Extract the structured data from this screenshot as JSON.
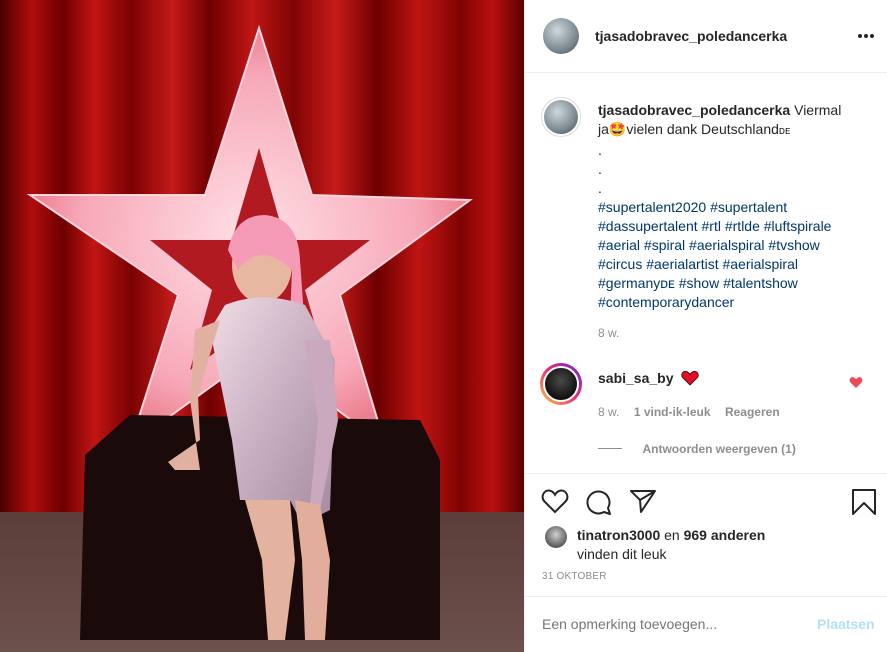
{
  "post": {
    "image_alt": "Photo of an aerial performer in front of an illuminated star"
  },
  "header": {
    "username": "tjasadobravec_poledancerka",
    "more_icon": "more-horizontal-icon"
  },
  "caption": {
    "username": "tjasadobravec_poledancerka",
    "text_line1": "Viermal",
    "text_line2_pre": "ja",
    "emoji": "🤩",
    "text_line2_post": "vielen dank Deutschland",
    "flag": "ᴅᴇ",
    "dots": [
      ".",
      ".",
      "."
    ],
    "hashtags_lines": [
      "#supertalent2020 #supertalent",
      "#dassupertalent #rtl #rtlde #luftspirale",
      "#aerial #spiral #aerialspiral #tvshow",
      "#circus #aerialartist #aerialspiral",
      "#germanyᴅᴇ #show #talentshow",
      "#contemporarydancer"
    ],
    "age": "8 w."
  },
  "comment": {
    "username": "sabi_sa_by",
    "emoji": "heart",
    "age": "8 w.",
    "likes": "1 vind-ik-leuk",
    "reply": "Reageren",
    "view_replies": "Antwoorden weergeven (1)"
  },
  "likes": {
    "user": "tinatron3000",
    "and": "en",
    "count": "969 anderen",
    "suffix": "vinden dit leuk"
  },
  "date": "31 OKTOBER",
  "add_comment": {
    "placeholder": "Een opmerking toevoegen...",
    "post_button": "Plaatsen"
  },
  "colors": {
    "link": "#00376b",
    "post_button": "#b2dffc",
    "heart": "#ed4956",
    "muted": "#8e8e8e"
  }
}
